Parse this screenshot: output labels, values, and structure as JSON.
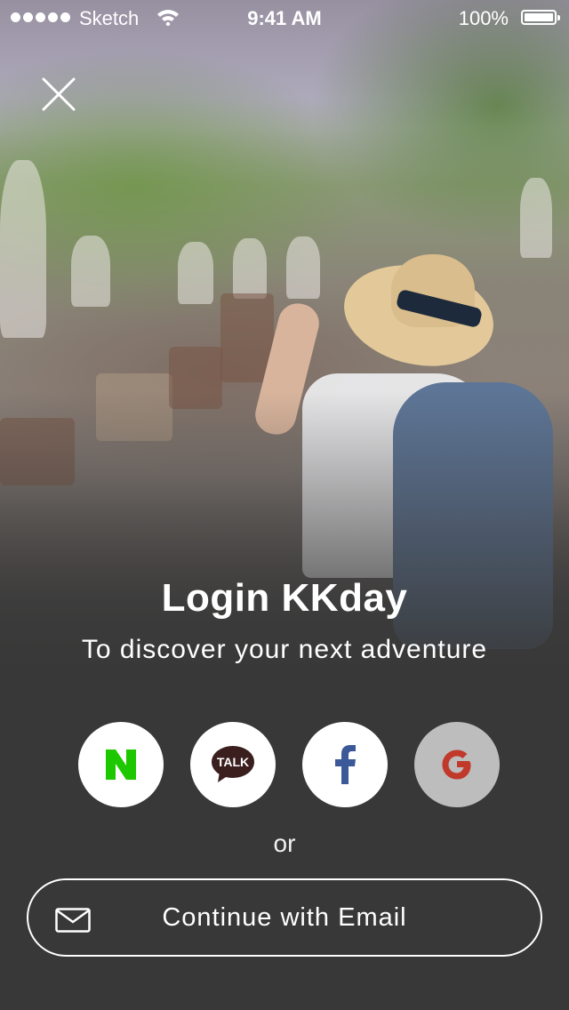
{
  "status_bar": {
    "carrier": "Sketch",
    "time": "9:41 AM",
    "battery_percent": "100%",
    "battery_level": 1.0,
    "signal_bars": 5
  },
  "close": {
    "icon": "close-icon"
  },
  "hero": {
    "title": "Login KKday",
    "subtitle": "To discover your next adventure"
  },
  "social_logins": [
    {
      "name": "naver",
      "glyph": "N",
      "color": "#1ec800"
    },
    {
      "name": "kakao",
      "glyph": "TALK",
      "color": "#3b1e1e"
    },
    {
      "name": "facebook",
      "glyph": "f",
      "color": "#3b5998"
    },
    {
      "name": "google",
      "glyph": "G",
      "color": "#c0392b"
    }
  ],
  "divider_text": "or",
  "email_button": {
    "label": "Continue with Email",
    "icon": "mail-icon"
  },
  "colors": {
    "background": "#383838",
    "text": "#ffffff"
  }
}
